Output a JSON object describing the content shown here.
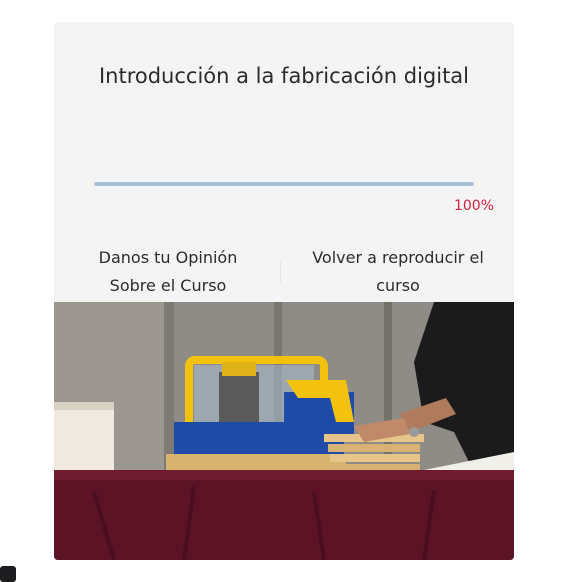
{
  "course": {
    "title": "Introducción a la fabricación digital",
    "progress_percent": 100,
    "progress_label": "100%"
  },
  "actions": {
    "feedback_label": "Danos tu Opinión Sobre el Curso",
    "replay_label": "Volver a reproducir el curso"
  },
  "colors": {
    "card_background": "#f4f4f4",
    "progress_fill": "#a9c1d8",
    "percent_text": "#d11f3f"
  }
}
